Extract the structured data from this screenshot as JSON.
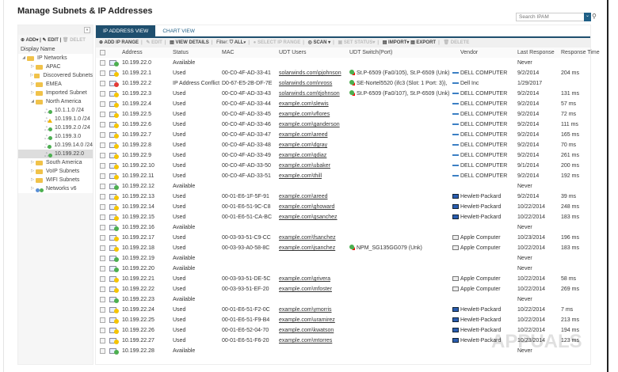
{
  "title": "Manage Subnets & IP Addresses",
  "search": {
    "placeholder": "Search IPAM"
  },
  "left": {
    "add": "ADD",
    "edit": "EDIT",
    "delete": "DELET",
    "display_name": "Display Name",
    "tree": [
      {
        "label": "IP Networks",
        "level": 0,
        "type": "folder",
        "open": true
      },
      {
        "label": "APAC",
        "level": 1,
        "type": "folder"
      },
      {
        "label": "Discovered Subnets",
        "level": 1,
        "type": "folder"
      },
      {
        "label": "EMEA",
        "level": 1,
        "type": "folder"
      },
      {
        "label": "Imported Subnet",
        "level": 1,
        "type": "folder"
      },
      {
        "label": "North America",
        "level": 1,
        "type": "folder",
        "open": true
      },
      {
        "label": "10.1.1.0 /24",
        "level": 2,
        "type": "subnet",
        "status": "ok"
      },
      {
        "label": "10.199.1.0 /24",
        "level": 2,
        "type": "subnet",
        "status": "warn"
      },
      {
        "label": "10.199.2.0 /24",
        "level": 2,
        "type": "subnet",
        "status": "ok"
      },
      {
        "label": "10.199.3.0",
        "level": 2,
        "type": "subnet",
        "status": "ok"
      },
      {
        "label": "10.199.14.0 /24",
        "level": 2,
        "type": "subnet",
        "status": "ok"
      },
      {
        "label": "10.199.22.0",
        "level": 2,
        "type": "subnet",
        "status": "ok",
        "selected": true
      },
      {
        "label": "South America",
        "level": 1,
        "type": "folder"
      },
      {
        "label": "VoIP Subnets",
        "level": 1,
        "type": "folder"
      },
      {
        "label": "WIFI Subnets",
        "level": 1,
        "type": "folder"
      },
      {
        "label": "Networks v6",
        "level": 1,
        "type": "v6"
      }
    ]
  },
  "tabs": [
    "IP ADDRESS VIEW",
    "CHART VIEW"
  ],
  "toolbar": {
    "add_range": "ADD IP RANGE",
    "edit": "EDIT",
    "view_details": "VIEW DETAILS",
    "filter": "Filter:",
    "all": "ALL",
    "select_range": "SELECT IP RANGE",
    "scan": "SCAN",
    "set_status": "SET STATUS",
    "import": "IMPORT",
    "export": "EXPORT",
    "delete": "DELETE"
  },
  "columns": [
    "Address",
    "Status",
    "MAC",
    "UDT Users",
    "UDT Switch(Port)",
    "Vendor",
    "Last Response",
    "Response Time"
  ],
  "colors": {
    "available": "#4caf50",
    "used": "#f5c400",
    "conflict": "#e53935",
    "accent": "#1f4f6e"
  },
  "rows": [
    [
      "10.199.22.0",
      "Available",
      "",
      "",
      "",
      "",
      "Never",
      ""
    ],
    [
      "10.199.22.1",
      "Used",
      "00-C0-4F-AD-33-41",
      "solarwinds.com\\pjohnson",
      "St.P-6509 (Fa0/105), St.P-6509 (Unk)",
      "DELL COMPUTER",
      "9/2/2014",
      "204 ms"
    ],
    [
      "10.199.22.2",
      "IP Address Conflict",
      "D0-67-E5-2B-DF-7E",
      "solarwinds.com\\nross",
      "SE-Nortel5520 (ifc3 (Slot: 1 Port: 3)),",
      "Dell Inc",
      "1/29/2017",
      ""
    ],
    [
      "10.199.22.3",
      "Used",
      "00-C0-4F-AD-33-43",
      "solarwinds.com\\tjohnson",
      "St.P-6509 (Fa0/107), St.P-6509 (Unk)",
      "DELL COMPUTER",
      "9/2/2014",
      "131 ms"
    ],
    [
      "10.199.22.4",
      "Used",
      "00-C0-4F-AD-33-44",
      "example.com\\slewis",
      "",
      "DELL COMPUTER",
      "9/2/2014",
      "57 ms"
    ],
    [
      "10.199.22.5",
      "Used",
      "00-C0-4F-AD-33-45",
      "example.com\\vflores",
      "",
      "DELL COMPUTER",
      "9/2/2014",
      "72 ms"
    ],
    [
      "10.199.22.6",
      "Used",
      "00-C0-4F-AD-33-46",
      "example.com\\ganderson",
      "",
      "DELL COMPUTER",
      "9/2/2014",
      "111 ms"
    ],
    [
      "10.199.22.7",
      "Used",
      "00-C0-4F-AD-33-47",
      "example.com\\areed",
      "",
      "DELL COMPUTER",
      "9/2/2014",
      "165 ms"
    ],
    [
      "10.199.22.8",
      "Used",
      "00-C0-4F-AD-33-48",
      "example.com\\dgray",
      "",
      "DELL COMPUTER",
      "9/2/2014",
      "70 ms"
    ],
    [
      "10.199.22.9",
      "Used",
      "00-C0-4F-AD-33-49",
      "example.com\\qdiaz",
      "",
      "DELL COMPUTER",
      "9/2/2014",
      "261 ms"
    ],
    [
      "10.199.22.10",
      "Used",
      "00-C0-4F-AD-33-50",
      "example.com\\ubaker",
      "",
      "DELL COMPUTER",
      "9/1/2014",
      "200 ms"
    ],
    [
      "10.199.22.11",
      "Used",
      "00-C0-4F-AD-33-51",
      "example.com\\thill",
      "",
      "DELL COMPUTER",
      "9/2/2014",
      "192 ms"
    ],
    [
      "10.199.22.12",
      "Available",
      "",
      "",
      "",
      "",
      "Never",
      ""
    ],
    [
      "10.199.22.13",
      "Used",
      "00-01-E6-1F-5F-91",
      "example.com\\areed",
      "",
      "Hewlett-Packard",
      "9/2/2014",
      "39 ms"
    ],
    [
      "10.199.22.14",
      "Used",
      "00-01-E6-51-9C-C8",
      "example.com\\ghoward",
      "",
      "Hewlett-Packard",
      "10/22/2014",
      "248 ms"
    ],
    [
      "10.199.22.15",
      "Used",
      "00-01-E6-51-CA-BC",
      "example.com\\gsanchez",
      "",
      "Hewlett-Packard",
      "10/22/2014",
      "183 ms"
    ],
    [
      "10.199.22.16",
      "Available",
      "",
      "",
      "",
      "",
      "Never",
      ""
    ],
    [
      "10.199.22.17",
      "Used",
      "00-03-93-51-C9-CC",
      "example.com\\fsanchez",
      "",
      "Apple Computer",
      "10/23/2014",
      "196 ms"
    ],
    [
      "10.199.22.18",
      "Used",
      "00-03-93-A0-58-8C",
      "example.com\\jsanchez",
      "NPM_SG135GG079 (Unk)",
      "Apple Computer",
      "10/22/2014",
      "183 ms"
    ],
    [
      "10.199.22.19",
      "Available",
      "",
      "",
      "",
      "",
      "Never",
      ""
    ],
    [
      "10.199.22.20",
      "Available",
      "",
      "",
      "",
      "",
      "Never",
      ""
    ],
    [
      "10.199.22.21",
      "Used",
      "00-03-93-51-DE-5C",
      "example.com\\grivera",
      "",
      "Apple Computer",
      "10/22/2014",
      "58 ms"
    ],
    [
      "10.199.22.22",
      "Used",
      "00-03-93-51-EF-20",
      "example.com\\mfoster",
      "",
      "Apple Computer",
      "10/22/2014",
      "269 ms"
    ],
    [
      "10.199.22.23",
      "Available",
      "",
      "",
      "",
      "",
      "Never",
      ""
    ],
    [
      "10.199.22.24",
      "Used",
      "00-01-E6-51-F2-0C",
      "example.com\\ymorris",
      "",
      "Hewlett-Packard",
      "10/22/2014",
      "7 ms"
    ],
    [
      "10.199.22.25",
      "Used",
      "00-01-E6-51-F9-B4",
      "example.com\\uramirez",
      "",
      "Hewlett-Packard",
      "10/22/2014",
      "213 ms"
    ],
    [
      "10.199.22.26",
      "Used",
      "00-01-E6-52-04-70",
      "example.com\\kwatson",
      "",
      "Hewlett-Packard",
      "10/22/2014",
      "194 ms"
    ],
    [
      "10.199.22.27",
      "Used",
      "00-01-E6-51-F6-20",
      "example.com\\mtorres",
      "",
      "Hewlett-Packard",
      "10/23/2014",
      "123 ms"
    ],
    [
      "10.199.22.28",
      "Available",
      "",
      "",
      "",
      "",
      "Never",
      ""
    ]
  ]
}
